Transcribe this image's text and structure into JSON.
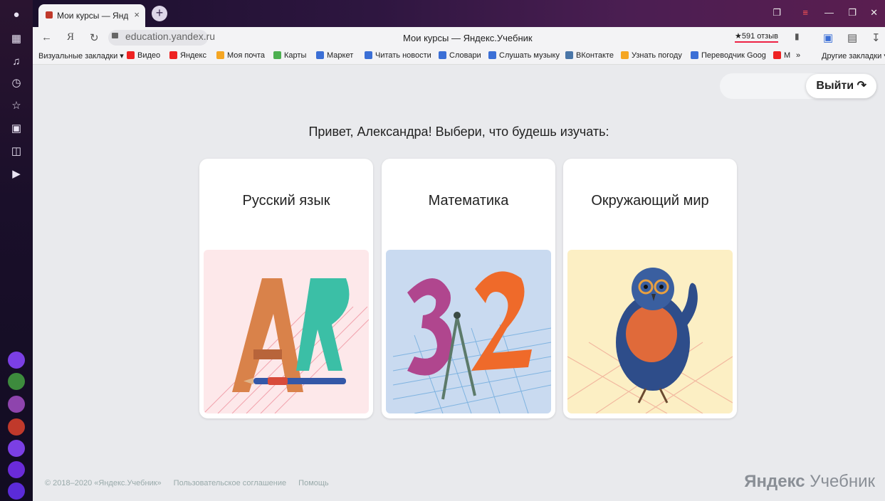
{
  "browser": {
    "tab_title": "Мои курсы — Яндекс.Уч",
    "tab_close": "×",
    "new_tab": "+",
    "url": "education.yandex.ru",
    "page_title": "Мои курсы — Яндекс.Учебник",
    "rating": "★591 отзыв",
    "bookmarks": [
      {
        "label": "Визуальные закладки ▾",
        "color": ""
      },
      {
        "label": "Видео",
        "color": "#e22"
      },
      {
        "label": "Яндекс",
        "color": "#e22"
      },
      {
        "label": "Моя почта",
        "color": "#f5a623"
      },
      {
        "label": "Карты",
        "color": "#4caf50"
      },
      {
        "label": "Маркет",
        "color": "#3b6fd6"
      },
      {
        "label": "Читать новости",
        "color": "#3b6fd6"
      },
      {
        "label": "Словари",
        "color": "#3b6fd6"
      },
      {
        "label": "Слушать музыку",
        "color": "#3b6fd6"
      },
      {
        "label": "ВКонтакте",
        "color": "#4a76a8"
      },
      {
        "label": "Узнать погоду",
        "color": "#f5a623"
      },
      {
        "label": "Переводчик Goog",
        "color": "#3b6fd6"
      },
      {
        "label": "М",
        "color": "#e22"
      }
    ],
    "bookmarks_more": "»",
    "other_bookmarks": "Другие закладки ▾"
  },
  "page": {
    "logout_label": "Выйти",
    "greeting": "Привет, Александра! Выбери, что будешь изучать:",
    "courses": [
      {
        "title": "Русский язык",
        "bg": "#fde8ea"
      },
      {
        "title": "Математика",
        "bg": "#c9daf0"
      },
      {
        "title": "Окружающий мир",
        "bg": "#fcefc4"
      }
    ],
    "footer": {
      "copyright": "© 2018–2020 «Яндекс.Учебник»",
      "agreement": "Пользовательское соглашение",
      "help": "Помощь"
    },
    "brand_bold": "Яндекс",
    "brand_rest": " Учебник"
  },
  "colors": {
    "accent_purple": "#6a2bd9"
  }
}
